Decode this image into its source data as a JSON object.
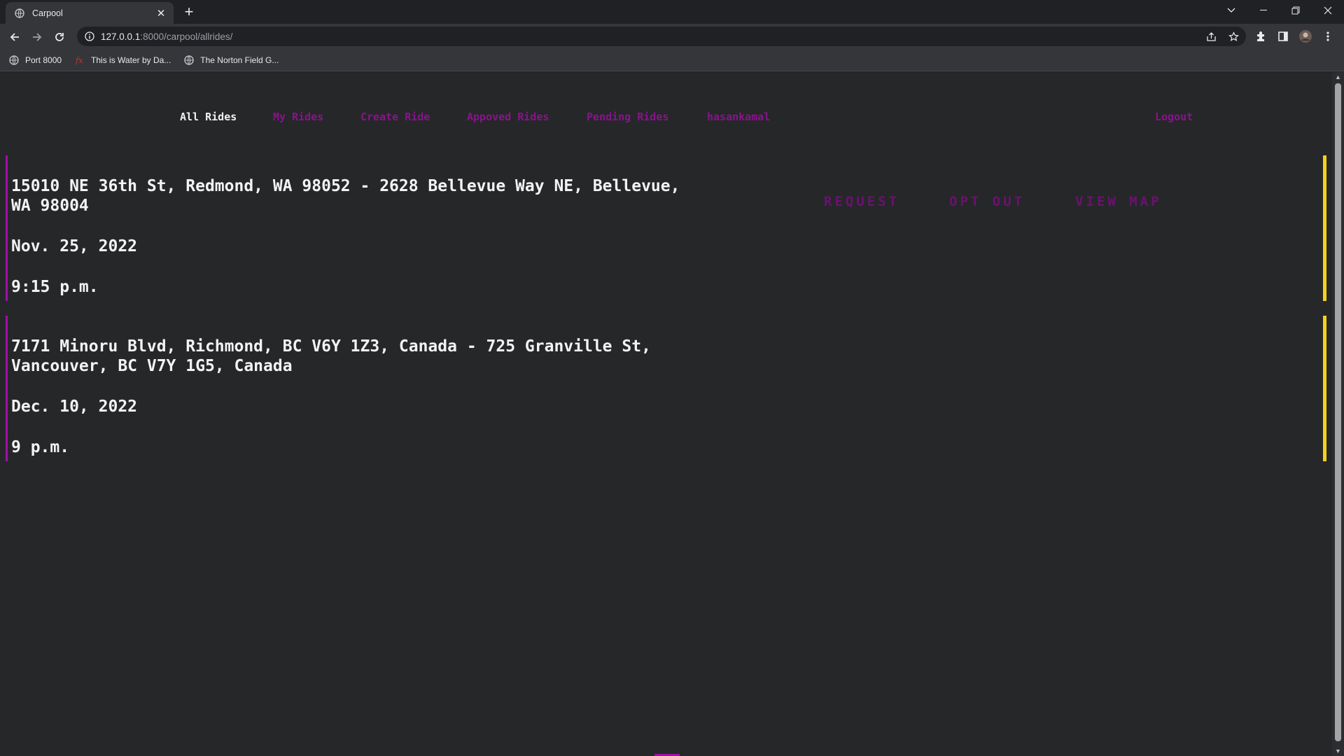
{
  "browser": {
    "tab_title": "Carpool",
    "tab_close": "✕",
    "new_tab": "+",
    "url_host": "127.0.0.1",
    "url_path": ":8000/carpool/allrides/",
    "bookmarks": [
      {
        "label": "Port 8000",
        "icon": "globe-icon"
      },
      {
        "label": "This is Water by Da...",
        "icon": "fx-icon"
      },
      {
        "label": "The Norton Field G...",
        "icon": "globe-icon"
      }
    ]
  },
  "nav": {
    "all_rides": "All Rides",
    "my_rides": "My Rides",
    "create_ride": "Create Ride",
    "approved_rides": "Appoved Rides",
    "pending_rides": "Pending Rides",
    "username": "hasankamal",
    "logout": "Logout"
  },
  "rides": [
    {
      "route": "15010 NE 36th St, Redmond, WA 98052 - 2628 Bellevue Way NE, Bellevue, WA 98004",
      "date": "Nov. 25, 2022",
      "time": "9:15 p.m."
    },
    {
      "route": "7171 Minoru Blvd, Richmond, BC V6Y 1Z3, Canada - 725 Granville St, Vancouver, BC V7Y 1G5, Canada",
      "date": "Dec. 10, 2022",
      "time": "9 p.m."
    }
  ],
  "actions": {
    "request": "REQUEST",
    "opt_out": "OPT OUT",
    "view_map": "VIEW MAP"
  },
  "colors": {
    "accent": "#a10ea8",
    "link": "#8b128e",
    "card_right_bar": "#f6d21a",
    "page_bg": "#262729"
  }
}
